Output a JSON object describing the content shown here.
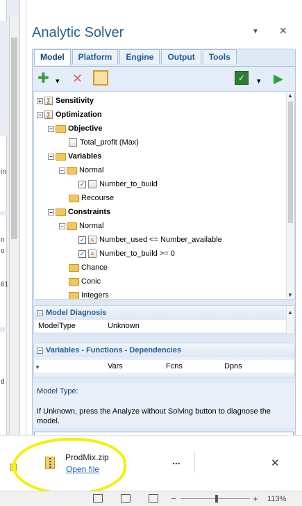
{
  "left_strip": {
    "fragments": [
      "in",
      "n",
      "o",
      "61",
      "d"
    ]
  },
  "panel": {
    "title": "Analytic Solver",
    "menu_glyph": "▼",
    "close_glyph": "✕"
  },
  "tabs": [
    {
      "label": "Model",
      "active": true
    },
    {
      "label": "Platform",
      "active": false
    },
    {
      "label": "Engine",
      "active": false
    },
    {
      "label": "Output",
      "active": false
    },
    {
      "label": "Tools",
      "active": false
    }
  ],
  "toolbar": {
    "add_glyph": "✚",
    "delete_glyph": "✕",
    "dropdown_glyph": "▾",
    "run_glyph": "▶"
  },
  "tree": [
    {
      "label": "Sensitivity",
      "expander": "+"
    },
    {
      "label": "Optimization",
      "expander": "−"
    },
    {
      "label": "Objective",
      "expander": "−"
    },
    {
      "label": "Total_profit (Max)"
    },
    {
      "label": "Variables",
      "expander": "−"
    },
    {
      "label": "Normal",
      "expander": "−"
    },
    {
      "label": "Number_to_build",
      "checked": "✓"
    },
    {
      "label": "Recourse"
    },
    {
      "label": "Constraints",
      "expander": "−"
    },
    {
      "label": "Normal",
      "expander": "−"
    },
    {
      "label": "Number_used <= Number_available",
      "checked": "✓"
    },
    {
      "label": "Number_to_build >= 0",
      "checked": "✓"
    },
    {
      "label": "Chance"
    },
    {
      "label": "Conic"
    },
    {
      "label": "Integers"
    }
  ],
  "diagnosis": {
    "header": "Model Diagnosis",
    "toggle": "−",
    "key": "ModelType",
    "value": "Unknown"
  },
  "dependencies": {
    "header": "Variables - Functions - Dependencies",
    "toggle": "−",
    "columns": [
      "Vars",
      "Fcns",
      "Dpns"
    ]
  },
  "description": {
    "title": "Model Type:",
    "text": "If Unknown, press the Analyze without Solving button to diagnose the model."
  },
  "download": {
    "filename": "ProdMix.zip",
    "open_link": "Open file",
    "more_glyph": "...",
    "close_glyph": "✕"
  },
  "statusbar": {
    "zoom_minus": "−",
    "zoom_plus": "+",
    "zoom_level": "113%"
  },
  "colors": {
    "highlight": "#f4f000",
    "accent": "#1f5c99",
    "run": "#2aa33a",
    "add": "#3c9a3c",
    "delete": "#e06060"
  }
}
